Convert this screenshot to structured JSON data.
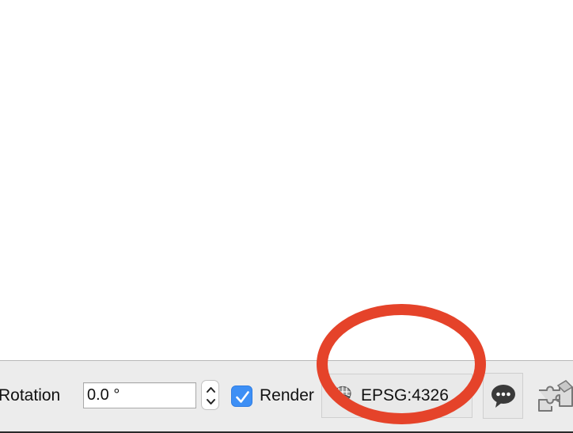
{
  "statusbar": {
    "rotation_label": "Rotation",
    "rotation_value": "0.0 °",
    "render_label": "Render",
    "render_checked": true,
    "crs_label": "EPSG:4326"
  },
  "icons": {
    "stepper": "up-down-chevron-icon",
    "checkbox": "checkmark-icon",
    "crs": "globe-grid-icon",
    "messages": "speech-bubble-icon",
    "plugin": "puzzle-piece-icon"
  },
  "colors": {
    "statusbar_bg": "#ececec",
    "checkbox_accent": "#3d8ff5",
    "annotation_red": "#e5432a"
  }
}
